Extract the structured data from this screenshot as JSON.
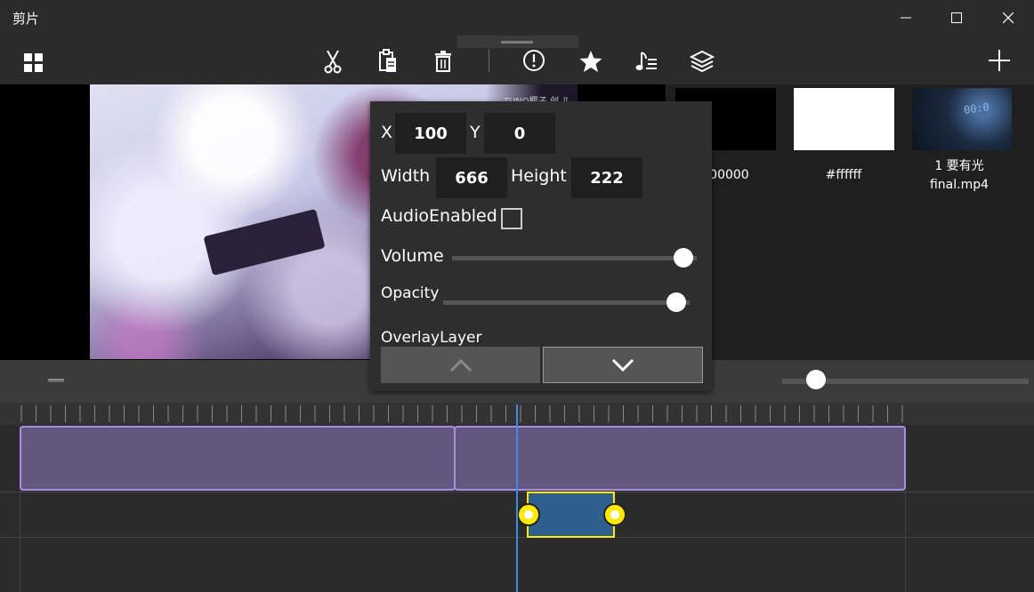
{
  "window": {
    "title": "剪片"
  },
  "toolbar": {
    "icons": [
      "grid-icon",
      "scissors-icon",
      "clipboard-icon",
      "trash-icon",
      "info-icon",
      "star-icon",
      "music-list-icon",
      "layers-icon",
      "plus-icon"
    ]
  },
  "preview": {
    "watermark": "TUNO椰子 创 ル"
  },
  "library": {
    "items": [
      {
        "label": "000000",
        "color": "#000000"
      },
      {
        "label": "#ffffff",
        "color": "#ffffff"
      },
      {
        "label": "1 要有光 final.mp4",
        "line1": "1 要有光",
        "line2": "final.mp4"
      }
    ]
  },
  "properties": {
    "x_label": "X",
    "x_value": "100",
    "y_label": "Y",
    "y_value": "0",
    "width_label": "Width",
    "width_value": "666",
    "height_label": "Height",
    "height_value": "222",
    "audio_enabled_label": "AudioEnabled",
    "audio_enabled": false,
    "volume_label": "Volume",
    "volume": 1.0,
    "opacity_label": "Opacity",
    "opacity": 1.0,
    "overlay_layer_label": "OverlayLayer"
  },
  "colors": {
    "clip_fill": "#64577f",
    "clip_border": "#a98ee0",
    "audio_clip": "#2e5f8e",
    "selection": "#ffea00",
    "playhead": "#3a8ce8"
  }
}
